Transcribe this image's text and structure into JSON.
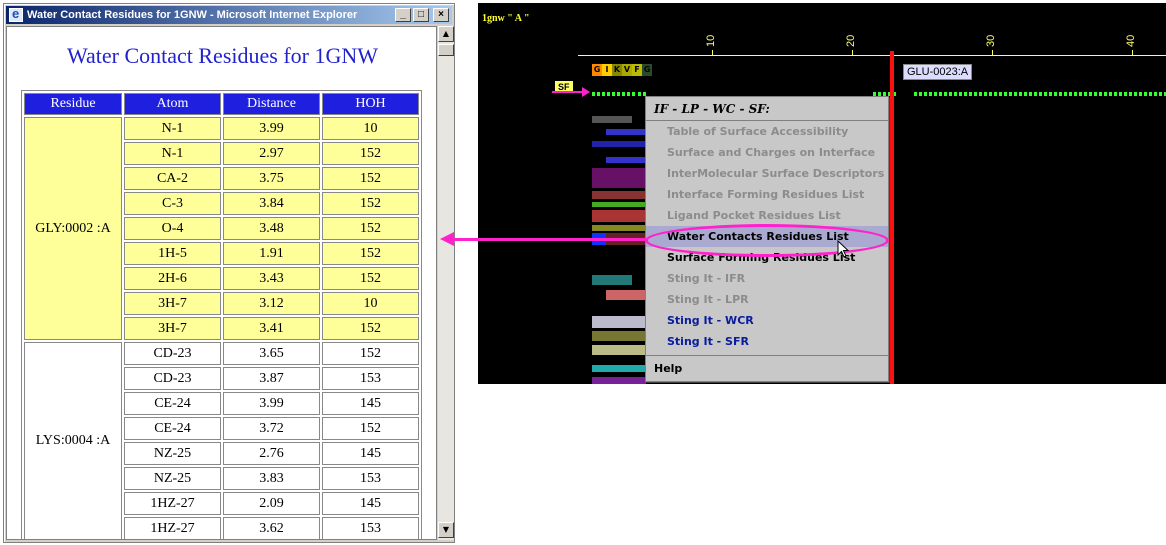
{
  "ie_window": {
    "title": "Water Contact Residues for 1GNW - Microsoft Internet Explorer",
    "minimize_label": "_",
    "maximize_label": "□",
    "close_label": "×"
  },
  "page": {
    "heading": "Water Contact Residues for 1GNW",
    "columns": [
      "Residue",
      "Atom",
      "Distance",
      "HOH"
    ],
    "groups": [
      {
        "residue": "GLY:0002 :A",
        "rows": [
          [
            "N-1",
            "3.99",
            "10"
          ],
          [
            "N-1",
            "2.97",
            "152"
          ],
          [
            "CA-2",
            "3.75",
            "152"
          ],
          [
            "C-3",
            "3.84",
            "152"
          ],
          [
            "O-4",
            "3.48",
            "152"
          ],
          [
            "1H-5",
            "1.91",
            "152"
          ],
          [
            "2H-6",
            "3.43",
            "152"
          ],
          [
            "3H-7",
            "3.12",
            "10"
          ],
          [
            "3H-7",
            "3.41",
            "152"
          ]
        ]
      },
      {
        "residue": "LYS:0004 :A",
        "rows": [
          [
            "CD-23",
            "3.65",
            "152"
          ],
          [
            "CD-23",
            "3.87",
            "153"
          ],
          [
            "CE-24",
            "3.99",
            "145"
          ],
          [
            "CE-24",
            "3.72",
            "152"
          ],
          [
            "NZ-25",
            "2.76",
            "145"
          ],
          [
            "NZ-25",
            "3.83",
            "153"
          ],
          [
            "1HZ-27",
            "2.09",
            "145"
          ],
          [
            "1HZ-27",
            "3.62",
            "153"
          ]
        ]
      }
    ]
  },
  "viewer": {
    "title": "1gnw \" A \"",
    "ticks": [
      "10",
      "20",
      "30",
      "40"
    ],
    "sequence": [
      "G",
      "I",
      "K",
      "V",
      "F",
      "G"
    ],
    "sequence_colors": [
      "#ff8800",
      "#ffcc00",
      "#888800",
      "#aaaa00",
      "#bbbb00",
      "#2a4a2a"
    ],
    "sf_label": "SF",
    "residue_label": "GLU-0023:A"
  },
  "popup_menu": {
    "header": "IF - LP - WC - SF:",
    "items": [
      {
        "label": "Table of Surface Accessibility",
        "state": "disabled"
      },
      {
        "label": "Surface and Charges on Interface",
        "state": "disabled"
      },
      {
        "label": "InterMolecular Surface Descriptors",
        "state": "disabled"
      },
      {
        "label": "Interface Forming Residues List",
        "state": "disabled"
      },
      {
        "label": "Ligand Pocket Residues List",
        "state": "disabled"
      },
      {
        "label": "Water Contacts Residues List",
        "state": "highlight"
      },
      {
        "label": "Surface Forming Residues List",
        "state": "enabled"
      },
      {
        "label": "Sting It - IFR",
        "state": "disabled"
      },
      {
        "label": "Sting It - LPR",
        "state": "disabled"
      },
      {
        "label": "Sting It - WCR",
        "state": "blue"
      },
      {
        "label": "Sting It - SFR",
        "state": "blue"
      }
    ],
    "help": "Help"
  },
  "colors": {
    "table_header": "#1f1fe0",
    "highlight_row": "#ffff99",
    "annotation": "#ff22cc",
    "marker_line": "#ff1010"
  }
}
